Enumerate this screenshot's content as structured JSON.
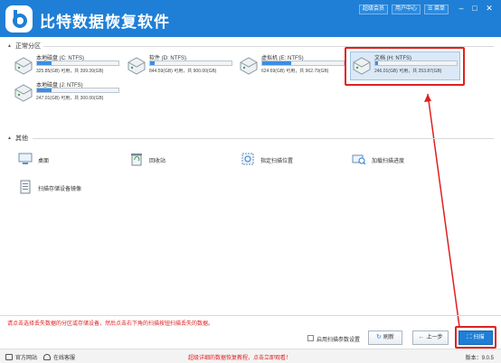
{
  "app": {
    "title": "比特数据恢复软件"
  },
  "topbar": {
    "vip_label": "超级会员",
    "user_center_label": "用户中心",
    "menu_label": "菜单"
  },
  "partitions": {
    "header": "正常分区",
    "drives": [
      {
        "name": "本地磁盘 (C: NTFS)",
        "size": "325.85(GB) 可用，共 399.39(GB)",
        "used_fraction": 0.18
      },
      {
        "name": "软件 (D: NTFS)",
        "size": "844.59(GB) 可用，共 900.00(GB)",
        "used_fraction": 0.06
      },
      {
        "name": "虚拟机 (E: NTFS)",
        "size": "624.69(GB) 可用，共 962.79(GB)",
        "used_fraction": 0.35
      },
      {
        "name": "文档 (H: NTFS)",
        "size": "246.01(GB) 可用，共 253.87(GB)",
        "used_fraction": 0.03
      },
      {
        "name": "本地磁盘 (J: NTFS)",
        "size": "247.01(GB) 可用，共 300.00(GB)",
        "used_fraction": 0.18
      }
    ]
  },
  "others": {
    "header": "其他",
    "items": [
      {
        "label": "桌面",
        "icon": "desktop-icon"
      },
      {
        "label": "回收站",
        "icon": "recycle-bin-icon"
      },
      {
        "label": "指定扫描位置",
        "icon": "scan-location-icon"
      },
      {
        "label": "加载扫描进度",
        "icon": "load-progress-icon"
      },
      {
        "label": "扫描存储设备镜像",
        "icon": "disk-image-icon"
      }
    ]
  },
  "hint": "请点击选择丢失数据的分区或存储设备，然后点击右下角的扫描按钮扫描丢失的数据。",
  "controls": {
    "advanced_scan_label": "启用扫描参数设置",
    "refresh_label": "刷新",
    "back_label": "上一步",
    "scan_label": "扫描"
  },
  "footer": {
    "website_label": "官方网站",
    "support_label": "在线客服",
    "promo": "超级详细的数据恢复教程，点击立即观看！",
    "version": "版本：9.0.5"
  },
  "colors": {
    "brand": "#1f7fd6",
    "highlight": "#e02020"
  }
}
